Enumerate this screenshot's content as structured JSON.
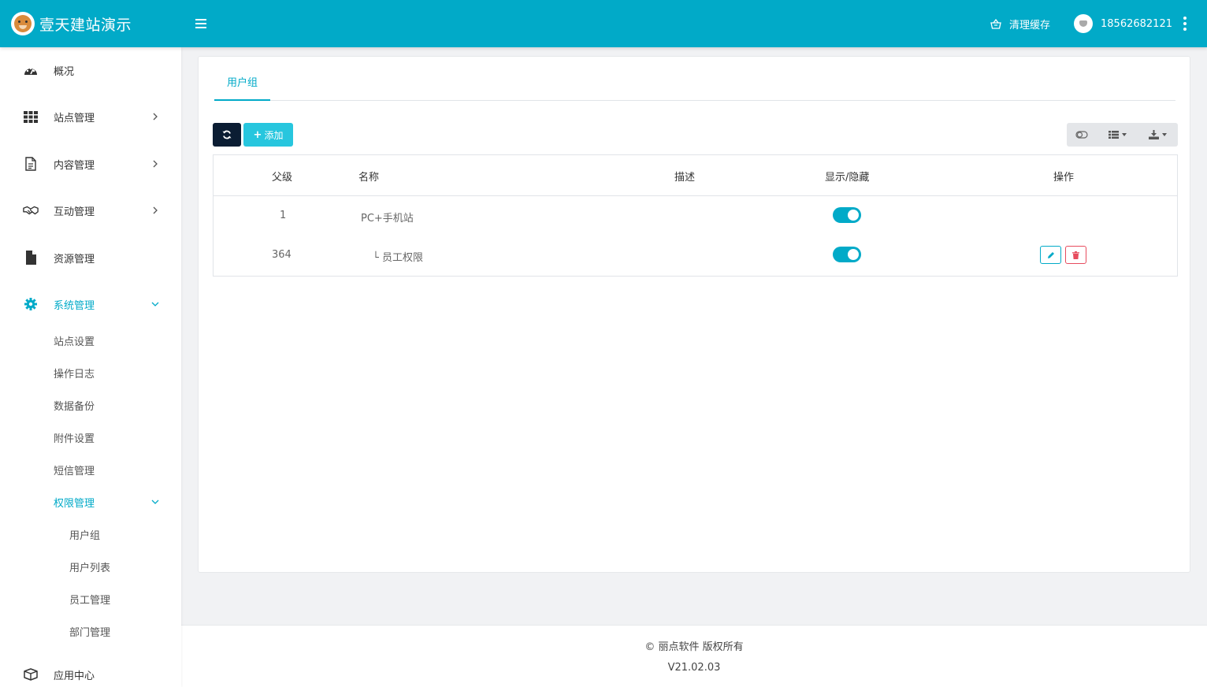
{
  "brand": {
    "title": "壹天建站演示"
  },
  "header": {
    "clear_cache_label": "清理缓存",
    "user_name": "18562682121"
  },
  "sidebar": {
    "items": [
      {
        "label": "概况",
        "icon": "dashboard-icon"
      },
      {
        "label": "站点管理",
        "icon": "grid-icon"
      },
      {
        "label": "内容管理",
        "icon": "document-icon"
      },
      {
        "label": "互动管理",
        "icon": "handshake-icon"
      },
      {
        "label": "资源管理",
        "icon": "file-icon"
      },
      {
        "label": "系统管理",
        "icon": "gear-icon",
        "active": true
      },
      {
        "label": "应用中心",
        "icon": "box-icon"
      }
    ],
    "system_sub": [
      {
        "label": "站点设置"
      },
      {
        "label": "操作日志"
      },
      {
        "label": "数据备份"
      },
      {
        "label": "附件设置"
      },
      {
        "label": "短信管理"
      },
      {
        "label": "权限管理",
        "active": true
      }
    ],
    "permission_sub": [
      {
        "label": "用户组"
      },
      {
        "label": "用户列表"
      },
      {
        "label": "员工管理"
      },
      {
        "label": "部门管理"
      }
    ]
  },
  "main": {
    "tab_label": "用户组",
    "add_label": "添加",
    "columns": [
      "父级",
      "名称",
      "描述",
      "显示/隐藏",
      "操作"
    ],
    "rows": [
      {
        "parent": "1",
        "name": "PC+手机站",
        "desc": "",
        "visible": true,
        "actions": false
      },
      {
        "parent": "364",
        "name": "└ 员工权限",
        "desc": "",
        "visible": true,
        "actions": true
      }
    ]
  },
  "footer": {
    "copyright": "© 丽点软件 版权所有",
    "version": "V21.02.03"
  },
  "colors": {
    "accent": "#01aac8",
    "dark_button": "#0b1d33",
    "add_button": "#27c6de",
    "danger": "#e74c5e"
  }
}
